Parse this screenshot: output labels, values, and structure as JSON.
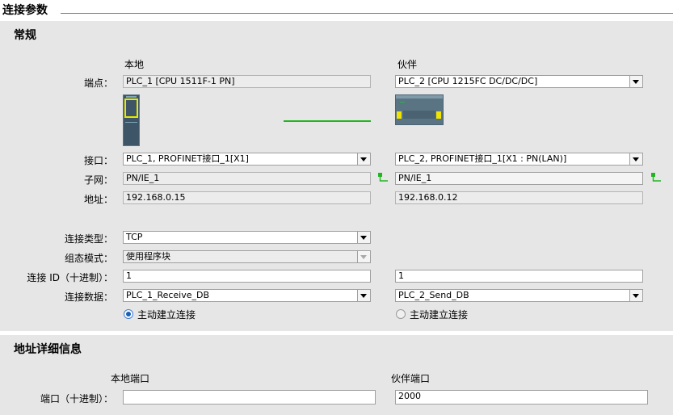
{
  "header": {
    "title": "连接参数"
  },
  "general": {
    "title": "常规",
    "local_heading": "本地",
    "partner_heading": "伙伴",
    "labels": {
      "endpoint": "端点：",
      "interface": "接口：",
      "subnet": "子网：",
      "address": "地址：",
      "connection_type": "连接类型：",
      "config_mode": "组态模式：",
      "connection_id": "连接 ID（十进制）：",
      "connection_data": "连接数据："
    },
    "local": {
      "endpoint": "PLC_1 [CPU 1511F-1 PN]",
      "interface": "PLC_1, PROFINET接口_1[X1]",
      "subnet": "PN/IE_1",
      "address": "192.168.0.15",
      "connection_type": "TCP",
      "config_mode": "使用程序块",
      "connection_id": "1",
      "connection_data": "PLC_1_Receive_DB",
      "active_label": "主动建立连接",
      "active_selected": true
    },
    "partner": {
      "endpoint": "PLC_2 [CPU 1215FC DC/DC/DC]",
      "interface": "PLC_2, PROFINET接口_1[X1 : PN(LAN)]",
      "subnet": "PN/IE_1",
      "address": "192.168.0.12",
      "connection_id": "1",
      "connection_data": "PLC_2_Send_DB",
      "active_label": "主动建立连接",
      "active_selected": false
    },
    "colors": {
      "link_line": "#22b422",
      "selection": "#1b5fb5"
    }
  },
  "address_details": {
    "title": "地址详细信息",
    "local_port_heading": "本地端口",
    "partner_port_heading": "伙伴端口",
    "port_label": "端口（十进制）：",
    "local_port": "",
    "partner_port": "2000"
  }
}
